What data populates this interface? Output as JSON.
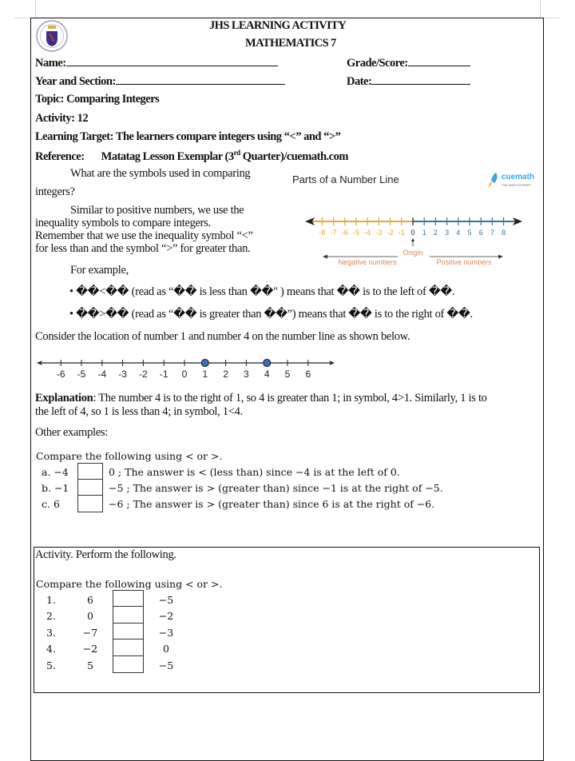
{
  "header": {
    "title": "JHS LEARNING ACTIVITY",
    "subject": "MATHEMATICS 7",
    "logo_icon": "deped-seal-icon"
  },
  "fields": {
    "name_label": "Name:",
    "grade_label": "Grade/Score:",
    "section_label": "Year and Section:",
    "date_label": "Date:",
    "name_value": "",
    "grade_value": "",
    "section_value": "",
    "date_value": ""
  },
  "meta": {
    "topic": "Topic: Comparing Integers",
    "activity": "Activity: 12",
    "learning_target": "Learning Target: The learners compare integers using “<” and “>”",
    "reference_label": "Reference:",
    "reference_value_pre": "Matatag Lesson Exemplar (3",
    "reference_value_sup": "rd",
    "reference_value_post": " Quarter)/cuemath.com"
  },
  "intro": {
    "question_line1": "What are the symbols used in comparing",
    "question_line2": "integers?",
    "para_line1": "Similar to positive numbers, we use the",
    "para_line2": "inequality symbols to compare integers.",
    "para_line3": "Remember that we use the inequality symbol “<”",
    "para_line4": "for less than and the symbol “>” for greater than.",
    "for_example": "For example,"
  },
  "figure_parts": {
    "title": "Parts of a Number Line",
    "brand": "cuemath",
    "brand_tagline": "THE MATH EXPERT",
    "negative_ticks": [
      "-8",
      "-7",
      "-6",
      "-5",
      "-4",
      "-3",
      "-2",
      "-1"
    ],
    "origin_tick": "0",
    "positive_ticks": [
      "1",
      "2",
      "3",
      "4",
      "5",
      "6",
      "7",
      "8"
    ],
    "origin_label": "Origin",
    "negative_label": "Negative numbers",
    "positive_label": "Positive numbers",
    "negative_color": "#e2a93b",
    "positive_color": "#3a7590",
    "label_color": "#d9895a"
  },
  "bullets": [
    "• ��<�� (read as “�� is less than ��\" ) means that �� is to the left of ��.",
    "• ��>�� (read as “�� is greater than ��”) means that �� is to the right of ��."
  ],
  "consider_text": "Consider the location of number 1 and number 4 on the number line as shown below.",
  "figure_points": {
    "ticks": [
      "-6",
      "-5",
      "-4",
      "-3",
      "-2",
      "-1",
      "0",
      "1",
      "2",
      "3",
      "4",
      "5",
      "6"
    ],
    "highlighted": [
      1,
      4
    ],
    "point_color": "#3d6fb0"
  },
  "explanation": {
    "label": "Explanation",
    "line1": ": The number 4 is to the right of 1, so 4 is greater than 1; in symbol, 4>1. Similarly, 1 is to",
    "line2": "the left of 4, so 1 is less than 4; in symbol, 1<4."
  },
  "other_examples": "Other examples:",
  "examples": {
    "heading": "Compare the following using < or >.",
    "rows": [
      {
        "label": "a. −4",
        "answer": "",
        "rest": "0 ; The answer is < (less than) since −4 is at the left of 0."
      },
      {
        "label": "b. −1",
        "answer": "",
        "rest": "−5 ; The answer is > (greater than) since −1 is at the right of −5."
      },
      {
        "label": "c. 6",
        "answer": "",
        "rest": "−6  ; The answer is > (greater than) since 6 is at the right of −6."
      }
    ]
  },
  "activity": {
    "title": "Activity. Perform the following.",
    "heading": "Compare the following using < or >.",
    "rows": [
      {
        "num": "1.",
        "left": "6",
        "answer": "",
        "right": "−5"
      },
      {
        "num": "2.",
        "left": "0",
        "answer": "",
        "right": "−2"
      },
      {
        "num": "3.",
        "left": "−7",
        "answer": "",
        "right": "−3"
      },
      {
        "num": "4.",
        "left": "−2",
        "answer": "",
        "right": "0"
      },
      {
        "num": "5.",
        "left": "5",
        "answer": "",
        "right": "−5"
      }
    ]
  }
}
